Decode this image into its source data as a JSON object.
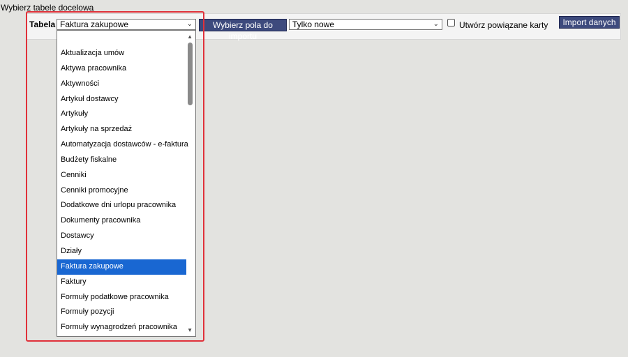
{
  "page": {
    "heading": "Wybierz tabelę docelową"
  },
  "toolbar": {
    "tabela_label": "Tabela",
    "table_select_value": "Faktura zakupowe",
    "choose_fields_button": "Wybierz pola do importu",
    "mode_select_value": "Tylko nowe",
    "create_related_label": "Utwórz powiązane karty",
    "create_related_checked": false,
    "import_button": "Import danych"
  },
  "dropdown": {
    "selected": "Faktura zakupowe",
    "items": [
      "Aktualizacja umów",
      "Aktywa pracownika",
      "Aktywności",
      "Artykuł dostawcy",
      "Artykuły",
      "Artykuły na sprzedaż",
      "Automatyzacja dostawców - e-faktura",
      "Budżety fiskalne",
      "Cenniki",
      "Cenniki promocyjne",
      "Dodatkowe dni urlopu pracownika",
      "Dokumenty pracownika",
      "Dostawcy",
      "Działy",
      "Faktura zakupowe",
      "Faktury",
      "Formuły podatkowe pracownika",
      "Formuły pozycji",
      "Formuły wynagrodzeń pracownika"
    ]
  },
  "colors": {
    "accent_button": "#3d4a7d",
    "selection": "#1967d2",
    "highlight_frame": "#e0313a"
  }
}
